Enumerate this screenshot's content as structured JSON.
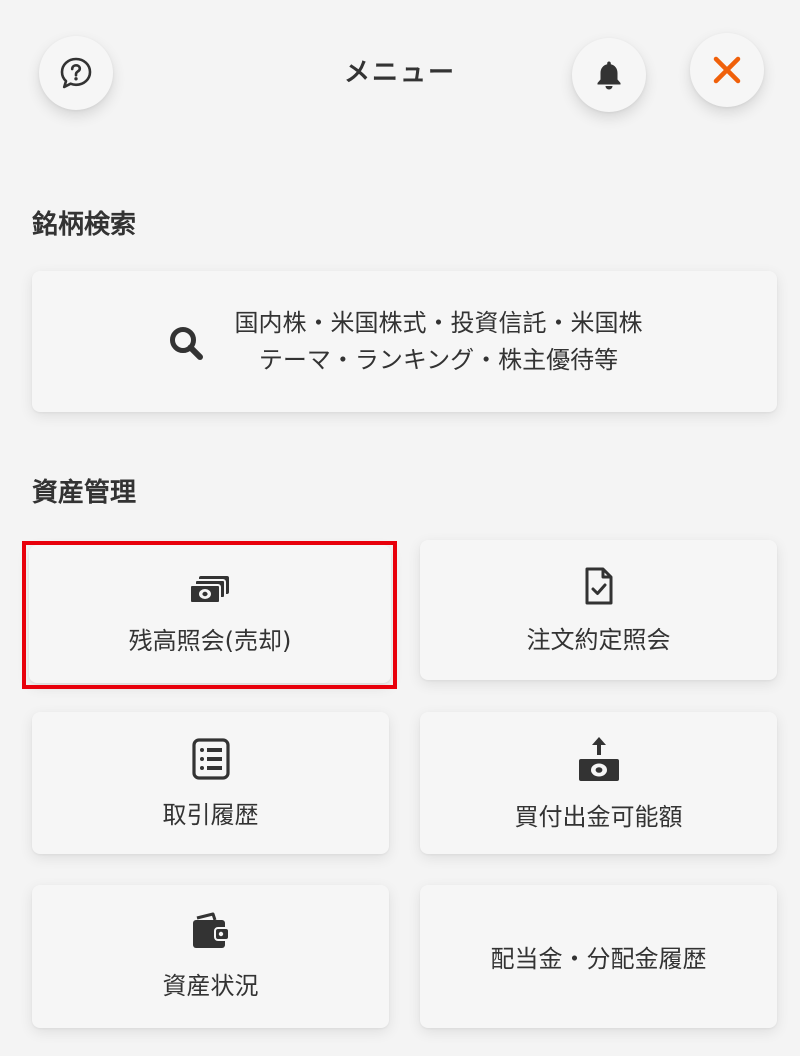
{
  "header": {
    "title": "メニュー",
    "help_icon": "question-bubble-icon",
    "bell_icon": "bell-icon",
    "close_icon": "close-icon",
    "close_color": "#f0600a"
  },
  "sections": {
    "search": {
      "heading": "銘柄検索",
      "card": {
        "icon": "search-icon",
        "line1": "国内株・米国株式・投資信託・米国株",
        "line2": "テーマ・ランキング・株主優待等"
      }
    },
    "assets": {
      "heading": "資産管理",
      "items": [
        {
          "label": "残高照会(売却)",
          "icon": "banknotes-icon",
          "highlighted": true
        },
        {
          "label": "注文約定照会",
          "icon": "document-check-icon"
        },
        {
          "label": "取引履歴",
          "icon": "list-document-icon"
        },
        {
          "label": "買付出金可能額",
          "icon": "money-withdraw-icon"
        },
        {
          "label": "資産状況",
          "icon": "wallet-icon"
        },
        {
          "label": "配当金・分配金履歴",
          "icon": ""
        }
      ]
    }
  },
  "colors": {
    "background": "#f4f4f4",
    "text": "#333333",
    "highlight": "#e8000b",
    "accent": "#f0600a"
  }
}
